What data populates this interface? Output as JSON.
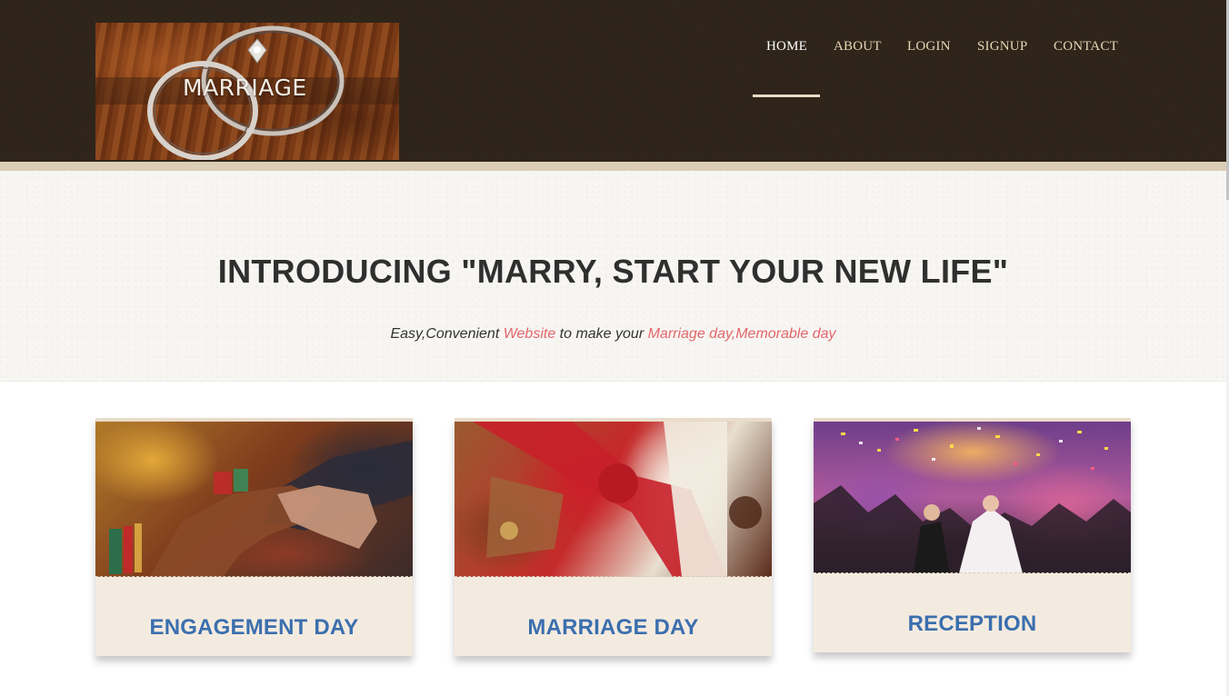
{
  "brand": {
    "logo_text": "MARRIAGE"
  },
  "nav": {
    "items": [
      {
        "label": "HOME",
        "active": true
      },
      {
        "label": "ABOUT",
        "active": false
      },
      {
        "label": "LOGIN",
        "active": false
      },
      {
        "label": "SIGNUP",
        "active": false
      },
      {
        "label": "CONTACT",
        "active": false
      }
    ]
  },
  "hero": {
    "title": "INTRODUCING \"MARRY, START YOUR NEW LIFE\"",
    "subtitle": {
      "part1": "Easy,Convenient ",
      "highlight1": "Website",
      "part2": " to make your ",
      "highlight2": "Marriage day,Memorable day"
    }
  },
  "cards": [
    {
      "caption": "ENGAGEMENT DAY",
      "image": "engagement-photo"
    },
    {
      "caption": "MARRIAGE DAY",
      "image": "marriage-photo"
    },
    {
      "caption": "RECEPTION",
      "image": "reception-photo"
    }
  ],
  "colors": {
    "header_bg": "#2e2419",
    "nav_text": "#e7d7b6",
    "highlight": "#e2666a",
    "caption": "#3b6fae",
    "card_bg": "#f4ebe0"
  }
}
